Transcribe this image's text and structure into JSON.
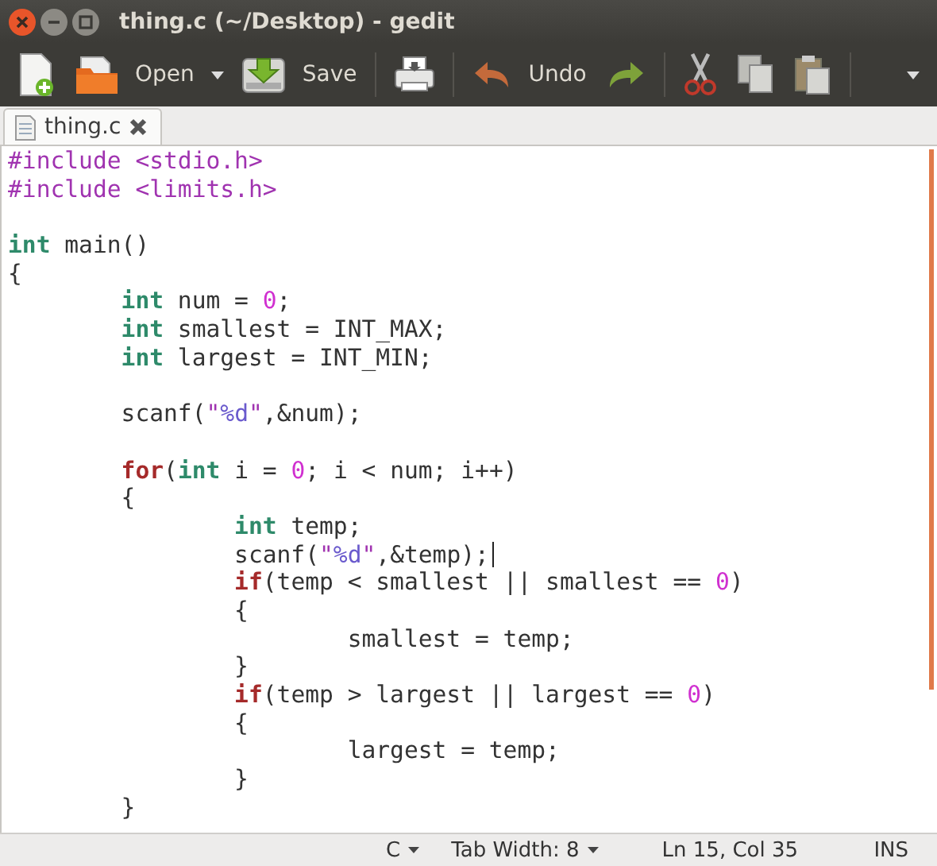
{
  "window": {
    "title": "thing.c (~/Desktop) - gedit"
  },
  "toolbar": [
    {
      "kind": "new"
    },
    {
      "kind": "open",
      "label": "Open",
      "menu": true
    },
    {
      "kind": "save",
      "label": "Save"
    },
    {
      "kind": "print"
    },
    {
      "kind": "undo",
      "label": "Undo"
    },
    {
      "kind": "redo"
    },
    {
      "kind": "cut"
    },
    {
      "kind": "copy"
    },
    {
      "kind": "paste"
    },
    {
      "kind": "overflow"
    }
  ],
  "tabs": [
    {
      "label": "thing.c",
      "selected": true
    }
  ],
  "code_lines": [
    {
      "cursor": false,
      "tokens": [
        {
          "kind": "preproc",
          "text": "#include "
        },
        {
          "kind": "include",
          "text": "<stdio.h>"
        }
      ]
    },
    {
      "cursor": false,
      "tokens": [
        {
          "kind": "preproc",
          "text": "#include "
        },
        {
          "kind": "include",
          "text": "<limits.h>"
        }
      ]
    },
    {
      "cursor": false
    },
    {
      "cursor": false,
      "tokens": [
        {
          "kind": "type",
          "text": "int"
        },
        {
          "kind": "plain",
          "text": " main()"
        }
      ]
    },
    {
      "cursor": false,
      "tokens": [
        {
          "kind": "plain",
          "text": "{"
        }
      ]
    },
    {
      "cursor": false,
      "tokens": [
        {
          "kind": "type",
          "text": "\tint"
        },
        {
          "kind": "plain",
          "text": " num = "
        },
        {
          "kind": "number",
          "text": "0"
        },
        {
          "kind": "plain",
          "text": ";"
        }
      ]
    },
    {
      "cursor": false,
      "tokens": [
        {
          "kind": "type",
          "text": "\tint"
        },
        {
          "kind": "plain",
          "text": " smallest = INT_MAX;"
        }
      ]
    },
    {
      "cursor": false,
      "tokens": [
        {
          "kind": "type",
          "text": "\tint"
        },
        {
          "kind": "plain",
          "text": " largest = INT_MIN;"
        }
      ]
    },
    {
      "cursor": false
    },
    {
      "cursor": false,
      "tokens": [
        {
          "kind": "plain",
          "text": "\tscanf("
        },
        {
          "kind": "string",
          "text": "\""
        },
        {
          "kind": "format",
          "text": "%d"
        },
        {
          "kind": "string",
          "text": "\""
        },
        {
          "kind": "plain",
          "text": ",&num);"
        }
      ]
    },
    {
      "cursor": false
    },
    {
      "cursor": false,
      "tokens": [
        {
          "kind": "control",
          "text": "\tfor"
        },
        {
          "kind": "plain",
          "text": "("
        },
        {
          "kind": "type",
          "text": "int"
        },
        {
          "kind": "plain",
          "text": " i = "
        },
        {
          "kind": "number",
          "text": "0"
        },
        {
          "kind": "plain",
          "text": "; i < num; i++)"
        }
      ]
    },
    {
      "cursor": false,
      "tokens": [
        {
          "kind": "plain",
          "text": "\t{"
        }
      ]
    },
    {
      "cursor": false,
      "tokens": [
        {
          "kind": "type",
          "text": "\t\tint"
        },
        {
          "kind": "plain",
          "text": " temp;"
        }
      ]
    },
    {
      "cursor": true,
      "tokens": [
        {
          "kind": "plain",
          "text": "\t\tscanf("
        },
        {
          "kind": "string",
          "text": "\""
        },
        {
          "kind": "format",
          "text": "%d"
        },
        {
          "kind": "string",
          "text": "\""
        },
        {
          "kind": "plain",
          "text": ",&temp);"
        }
      ]
    },
    {
      "cursor": false,
      "tokens": [
        {
          "kind": "control",
          "text": "\t\tif"
        },
        {
          "kind": "plain",
          "text": "(temp < smallest || smallest == "
        },
        {
          "kind": "number",
          "text": "0"
        },
        {
          "kind": "plain",
          "text": ")"
        }
      ]
    },
    {
      "cursor": false,
      "tokens": [
        {
          "kind": "plain",
          "text": "\t\t{"
        }
      ]
    },
    {
      "cursor": false,
      "tokens": [
        {
          "kind": "plain",
          "text": "\t\t\tsmallest = temp;"
        }
      ]
    },
    {
      "cursor": false,
      "tokens": [
        {
          "kind": "plain",
          "text": "\t\t}"
        }
      ]
    },
    {
      "cursor": false,
      "tokens": [
        {
          "kind": "control",
          "text": "\t\tif"
        },
        {
          "kind": "plain",
          "text": "(temp > largest || largest == "
        },
        {
          "kind": "number",
          "text": "0"
        },
        {
          "kind": "plain",
          "text": ")"
        }
      ]
    },
    {
      "cursor": false,
      "tokens": [
        {
          "kind": "plain",
          "text": "\t\t{"
        }
      ]
    },
    {
      "cursor": false,
      "tokens": [
        {
          "kind": "plain",
          "text": "\t\t\tlargest = temp;"
        }
      ]
    },
    {
      "cursor": false,
      "tokens": [
        {
          "kind": "plain",
          "text": "\t\t}"
        }
      ]
    },
    {
      "cursor": false,
      "tokens": [
        {
          "kind": "plain",
          "text": "\t}"
        }
      ]
    }
  ],
  "status_bar": {
    "language": "C",
    "tab_width": "Tab Width:  8",
    "position": "Ln 15, Col 35",
    "mode": "INS"
  }
}
